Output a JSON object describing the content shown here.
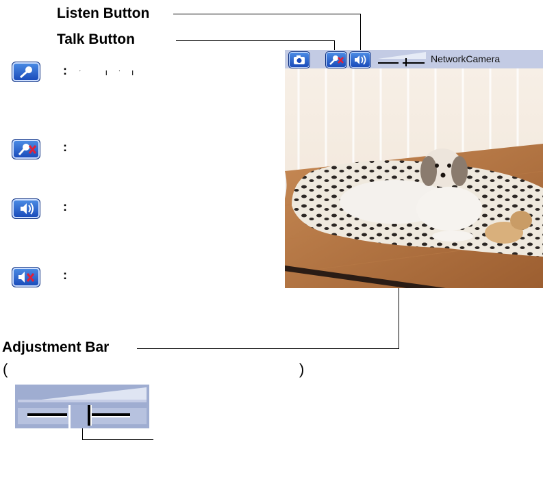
{
  "callouts": {
    "listen": "Listen Button",
    "talk": "Talk Button",
    "adjust": "Adjustment Bar"
  },
  "paren_open": "(",
  "paren_close": ")",
  "colon": ":",
  "camera": {
    "title": "NetworkCamera"
  },
  "icons": {
    "talk_on": "microphone-icon",
    "talk_off": "microphone-muted-icon",
    "listen_on": "speaker-icon",
    "listen_off": "speaker-muted-icon",
    "snapshot": "camera-icon"
  },
  "colors": {
    "toolbar": "#c3cbe4",
    "button_blue": "#1848b8",
    "mute_red": "#e0203a",
    "adjust_bar": "#9fadd1"
  }
}
